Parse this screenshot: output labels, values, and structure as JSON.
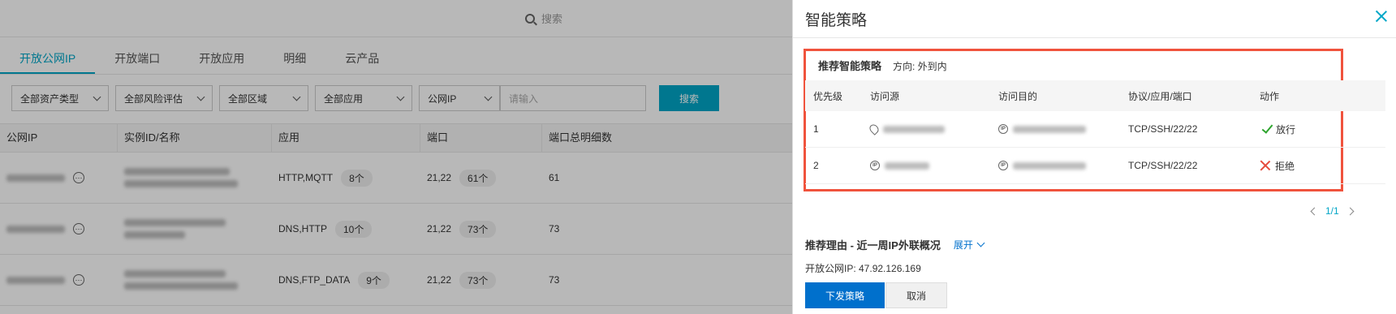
{
  "background": {
    "search_placeholder": "搜索",
    "tabs": [
      {
        "label": "开放公网IP",
        "active": true
      },
      {
        "label": "开放端口",
        "active": false
      },
      {
        "label": "开放应用",
        "active": false
      },
      {
        "label": "明细",
        "active": false
      },
      {
        "label": "云产品",
        "active": false
      }
    ],
    "filters": {
      "asset_type": "全部资产类型",
      "risk": "全部风险评估",
      "region": "全部区域",
      "app": "全部应用",
      "ip_type": "公网IP",
      "input_placeholder": "请输入",
      "search_button": "搜索"
    },
    "table": {
      "headers": [
        "公网IP",
        "实例ID/名称",
        "应用",
        "端口",
        "端口总明细数"
      ],
      "rows": [
        {
          "apps": "HTTP,MQTT",
          "apps_count": "8个",
          "ports": "21,22",
          "ports_count": "61个",
          "total": "61"
        },
        {
          "apps": "DNS,HTTP",
          "apps_count": "10个",
          "ports": "21,22",
          "ports_count": "73个",
          "total": "73"
        },
        {
          "apps": "DNS,FTP_DATA",
          "apps_count": "9个",
          "ports": "21,22",
          "ports_count": "73个",
          "total": "73"
        }
      ]
    }
  },
  "drawer": {
    "title": "智能策略",
    "recommend": {
      "title": "推荐智能策略",
      "direction": "方向: 外到内",
      "headers": {
        "priority": "优先级",
        "source": "访问源",
        "dest": "访问目的",
        "proto": "协议/应用/端口",
        "action": "动作"
      },
      "rows": [
        {
          "priority": "1",
          "proto": "TCP/SSH/22/22",
          "action": "放行",
          "action_type": "allow"
        },
        {
          "priority": "2",
          "proto": "TCP/SSH/22/22",
          "action": "拒绝",
          "action_type": "deny"
        }
      ]
    },
    "pager": "1/1",
    "reason_title": "推荐理由 - 近一周IP外联概况",
    "expand_label": "展开",
    "open_ip": "开放公网IP:  47.92.126.169",
    "submit_button": "下发策略",
    "cancel_button": "取消",
    "colors": {
      "accent": "#00a6c7",
      "primary": "#0070cc",
      "highlight_border": "#f0533d",
      "allow": "#2ea42e",
      "deny": "#e64b3c"
    }
  }
}
